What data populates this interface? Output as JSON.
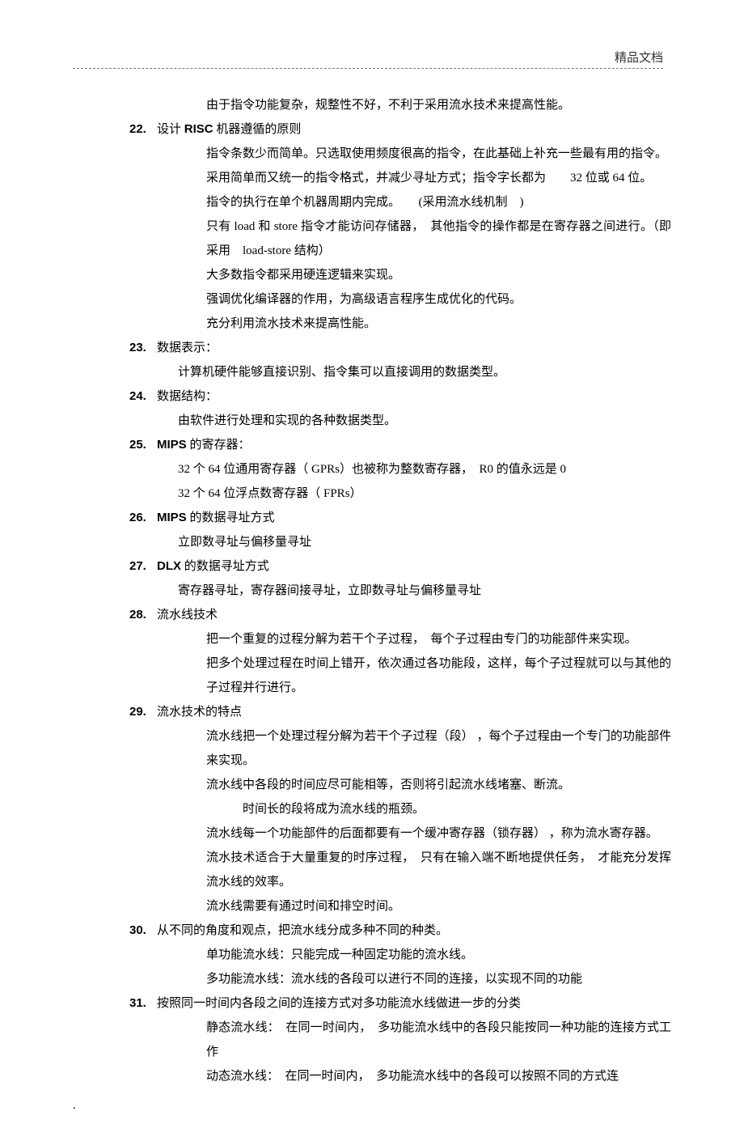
{
  "header": {
    "label": "精品文档"
  },
  "pre_line": "由于指令功能复杂，规整性不好，不利于采用流水技术来提高性能。",
  "items": [
    {
      "num": "22.",
      "title_pre": "设计 ",
      "title_bold": "RISC",
      "title_post": " 机器遵循的原则",
      "style": "deep",
      "body": [
        "指令条数少而简单。只选取使用频度很高的指令，在此基础上补充一些最有用的指令。",
        "采用简单而又统一的指令格式，并减少寻址方式；指令字长都为　　32 位或 64 位。",
        "指令的执行在单个机器周期内完成。　　(采用流水线机制　)",
        "只有 load 和 store 指令才能访问存储器，　其他指令的操作都是在寄存器之间进行。（即采用　load-store 结构）",
        "大多数指令都采用硬连逻辑来实现。",
        "强调优化编译器的作用，为高级语言程序生成优化的代码。",
        "充分利用流水技术来提高性能。"
      ]
    },
    {
      "num": "23.",
      "title": "数据表示：",
      "style": "b",
      "body": [
        "计算机硬件能够直接识别、指令集可以直接调用的数据类型。"
      ]
    },
    {
      "num": "24.",
      "title": "数据结构：",
      "style": "b",
      "body": [
        "由软件进行处理和实现的各种数据类型。"
      ]
    },
    {
      "num": "25.",
      "title_pre": "",
      "title_bold": "MIPS",
      "title_post": " 的寄存器：",
      "style": "b",
      "body": [
        "32 个 64 位通用寄存器（ GPRs）也被称为整数寄存器，　R0 的值永远是  0",
        "32 个 64 位浮点数寄存器（ FPRs）"
      ]
    },
    {
      "num": "26.",
      "title_pre": "",
      "title_bold": "MIPS",
      "title_post": " 的数据寻址方式",
      "style": "b",
      "body": [
        "立即数寻址与偏移量寻址"
      ]
    },
    {
      "num": "27.",
      "title_pre": "",
      "title_bold": "DLX",
      "title_post": " 的数据寻址方式",
      "style": "b",
      "body": [
        "寄存器寻址，寄存器间接寻址，立即数寻址与偏移量寻址"
      ]
    },
    {
      "num": "28.",
      "title": "流水线技术",
      "style": "deep",
      "body": [
        "把一个重复的过程分解为若干个子过程，　每个子过程由专门的功能部件来实现。",
        "把多个处理过程在时间上错开，依次通过各功能段，这样，每个子过程就可以与其他的子过程并行进行。"
      ]
    },
    {
      "num": "29.",
      "title": "流水技术的特点",
      "style": "deep",
      "extra_indent": true,
      "body": [
        "流水线把一个处理过程分解为若干个子过程（段） ，每个子过程由一个专门的功能部件来实现。",
        "流水线中各段的时间应尽可能相等，否则将引起流水线堵塞、断流。",
        "　时间长的段将成为流水线的瓶颈。",
        "流水线每一个功能部件的后面都要有一个缓冲寄存器（锁存器） ，称为流水寄存器。",
        "流水技术适合于大量重复的时序过程，　只有在输入端不断地提供任务，　才能充分发挥流水线的效率。",
        " 流水线需要有通过时间和排空时间。"
      ]
    },
    {
      "num": "30.",
      "title": "从不同的角度和观点，把流水线分成多种不同的种类。",
      "style": "deep",
      "body": [
        "单功能流水线：只能完成一种固定功能的流水线。",
        "多功能流水线：流水线的各段可以进行不同的连接，以实现不同的功能"
      ]
    },
    {
      "num": "31.",
      "title": "按照同一时间内各段之间的连接方式对多功能流水线做进一步的分类",
      "style": "deep",
      "body": [
        "静态流水线：　在同一时间内，　多功能流水线中的各段只能按同一种功能的连接方式工作",
        "动态流水线：　在同一时间内，　多功能流水线中的各段可以按照不同的方式连"
      ]
    }
  ],
  "footer_dot": "."
}
